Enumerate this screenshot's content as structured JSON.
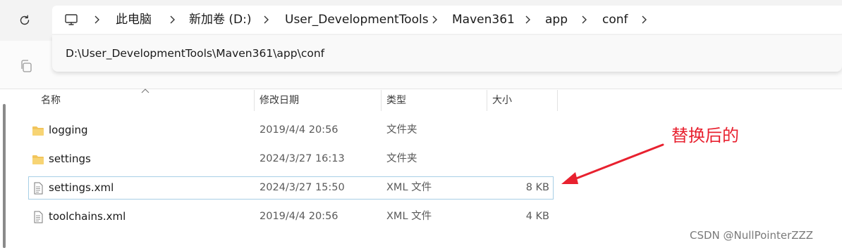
{
  "breadcrumb": {
    "items": [
      "此电脑",
      "新加卷 (D:)",
      "User_DevelopmentTools",
      "Maven361",
      "app",
      "conf"
    ]
  },
  "address_bar": {
    "path": "D:\\User_DevelopmentTools\\Maven361\\app\\conf"
  },
  "columns": {
    "name": "名称",
    "modified": "修改日期",
    "type": "类型",
    "size": "大小"
  },
  "files": [
    {
      "name": "logging",
      "modified": "2019/4/4 20:56",
      "type": "文件夹",
      "size": "",
      "icon": "folder-icon",
      "selected": false
    },
    {
      "name": "settings",
      "modified": "2024/3/27 16:13",
      "type": "文件夹",
      "size": "",
      "icon": "folder-icon",
      "selected": false
    },
    {
      "name": "settings.xml",
      "modified": "2024/3/27 15:50",
      "type": "XML 文件",
      "size": "8 KB",
      "icon": "xml-file-icon",
      "selected": true
    },
    {
      "name": "toolchains.xml",
      "modified": "2019/4/4 20:56",
      "type": "XML 文件",
      "size": "4 KB",
      "icon": "xml-file-icon",
      "selected": false
    }
  ],
  "annotation": {
    "text": "替换后的",
    "color": "#e8212f"
  },
  "watermark": "CSDN @NullPointerZZZ",
  "colors": {
    "folder": "#f2c55c",
    "selection_border": "#a8cfe6",
    "annotation_red": "#e8212f"
  }
}
